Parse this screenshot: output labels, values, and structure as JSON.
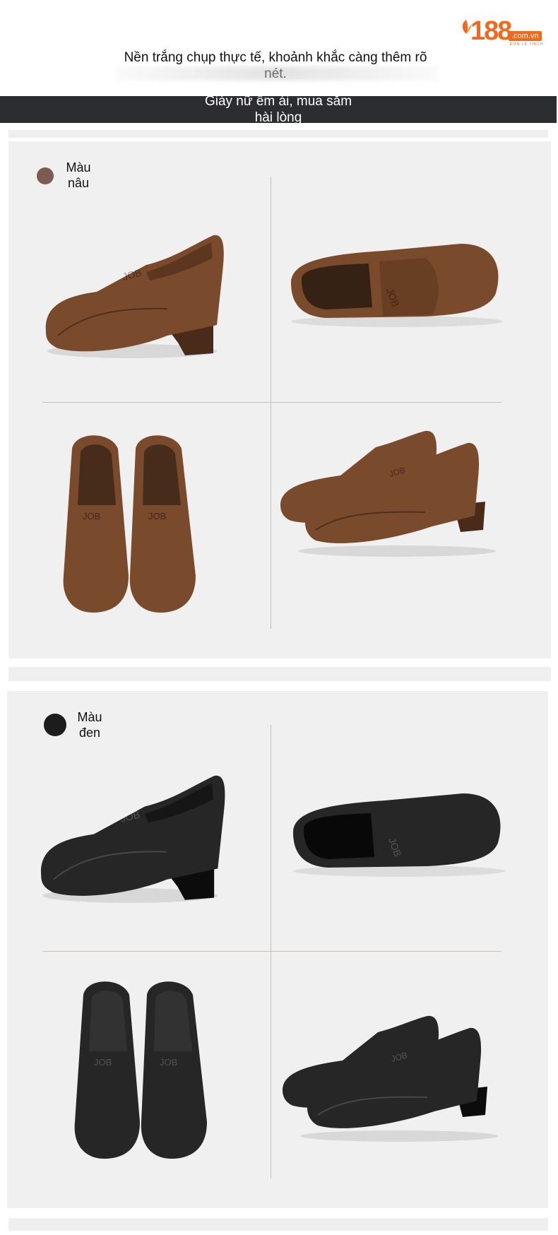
{
  "logo": {
    "number": "188",
    "domain": ".com.vn",
    "slogan": "ĐƠN LẺ THÍCH"
  },
  "header": {
    "tagline": "Nền trắng chụp thực tế, khoảnh khắc càng thêm rõ nét.",
    "banner_line1": "Giày nữ êm ái, mua sắm",
    "banner_line2": "hài lòng"
  },
  "variants": [
    {
      "label_line1": "Màu",
      "label_line2": "nâu",
      "swatch_color": "#7d5a52",
      "shoe_color": "#7a4a2c",
      "shoe_dark": "#4a2a18"
    },
    {
      "label_line1": "Màu",
      "label_line2": "đen",
      "swatch_color": "#1c1c1c",
      "shoe_color": "#262626",
      "shoe_dark": "#0c0c0c"
    }
  ],
  "colors": {
    "accent": "#ee6a1f",
    "banner_bg": "#2b2d30",
    "panel_bg": "#f0f0f0"
  }
}
